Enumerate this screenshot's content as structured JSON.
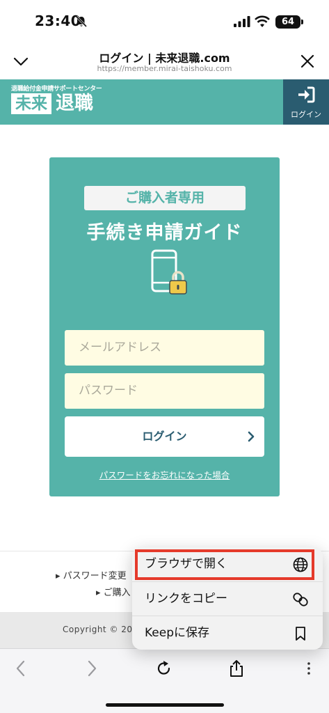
{
  "status_bar": {
    "time": "23:40",
    "battery": "64",
    "icons": [
      "bell-slash-icon",
      "cellular-signal-icon",
      "wifi-icon",
      "battery-icon"
    ]
  },
  "sheet_header": {
    "title": "ログイン | 未来退職.com",
    "url": "https://member.mirai-taishoku.com",
    "icons": [
      "chevron-down-icon",
      "close-icon"
    ]
  },
  "site_header": {
    "tagline": "退職給付金申請サポートセンター",
    "logo_box": "未来",
    "logo_text": "退職",
    "login_label": "ログイン",
    "background": "#55b3a9",
    "login_background": "#2a5c70"
  },
  "login_card": {
    "badge": "ご購入者専用",
    "title": "手続き申請ガイド",
    "email_placeholder": "メールアドレス",
    "password_placeholder": "パスワード",
    "login_button": "ログイン",
    "forgot_link": "パスワードをお忘れになった場合",
    "icon": "phone-lock-icon"
  },
  "footer": {
    "link_1": "パスワード変更",
    "link_2": "ご購入",
    "copyright": "Copyright © 202"
  },
  "context_menu": {
    "items": [
      {
        "label": "ブラウザで開く",
        "icon": "globe-icon",
        "highlighted": true
      },
      {
        "label": "リンクをコピー",
        "icon": "link-icon"
      },
      {
        "label": "Keepに保存",
        "icon": "bookmark-icon"
      }
    ],
    "highlight_color": "#e53a2b"
  },
  "toolbar": {
    "icons": [
      "back-icon",
      "forward-icon",
      "reload-icon",
      "share-icon",
      "more-icon"
    ]
  }
}
